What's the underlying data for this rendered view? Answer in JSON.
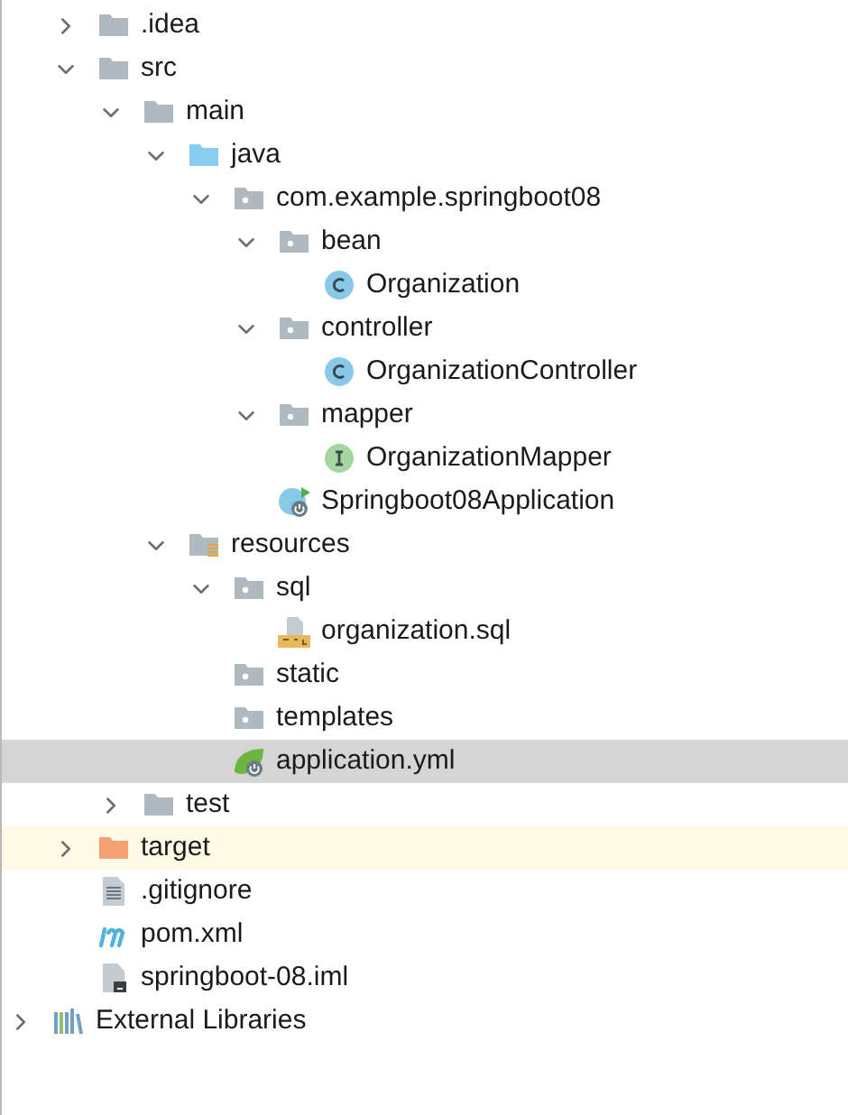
{
  "tree": [
    {
      "label": ".idea",
      "kind": "folder",
      "expanded": false,
      "selected": false,
      "highlighted": false
    },
    {
      "label": "src",
      "kind": "folder",
      "expanded": true,
      "selected": false,
      "highlighted": false,
      "children": [
        {
          "label": "main",
          "kind": "folder",
          "expanded": true,
          "selected": false,
          "highlighted": false,
          "children": [
            {
              "label": "java",
              "kind": "source_folder",
              "expanded": true,
              "selected": false,
              "highlighted": false,
              "children": [
                {
                  "label": "com.example.springboot08",
                  "kind": "package",
                  "expanded": true,
                  "selected": false,
                  "highlighted": false,
                  "children": [
                    {
                      "label": "bean",
                      "kind": "package",
                      "expanded": true,
                      "selected": false,
                      "highlighted": false,
                      "children": [
                        {
                          "label": "Organization",
                          "kind": "class",
                          "selected": false,
                          "highlighted": false
                        }
                      ]
                    },
                    {
                      "label": "controller",
                      "kind": "package",
                      "expanded": true,
                      "selected": false,
                      "highlighted": false,
                      "children": [
                        {
                          "label": "OrganizationController",
                          "kind": "class",
                          "selected": false,
                          "highlighted": false
                        }
                      ]
                    },
                    {
                      "label": "mapper",
                      "kind": "package",
                      "expanded": true,
                      "selected": false,
                      "highlighted": false,
                      "children": [
                        {
                          "label": "OrganizationMapper",
                          "kind": "interface",
                          "selected": false,
                          "highlighted": false
                        }
                      ]
                    },
                    {
                      "label": "Springboot08Application",
                      "kind": "spring_class",
                      "selected": false,
                      "highlighted": false
                    }
                  ]
                }
              ]
            },
            {
              "label": "resources",
              "kind": "resources_folder",
              "expanded": true,
              "selected": false,
              "highlighted": false,
              "children": [
                {
                  "label": "sql",
                  "kind": "package",
                  "expanded": true,
                  "selected": false,
                  "highlighted": false,
                  "children": [
                    {
                      "label": "organization.sql",
                      "kind": "sql_file",
                      "selected": false,
                      "highlighted": false
                    }
                  ]
                },
                {
                  "label": "static",
                  "kind": "package",
                  "selected": false,
                  "highlighted": false
                },
                {
                  "label": "templates",
                  "kind": "package",
                  "selected": false,
                  "highlighted": false
                },
                {
                  "label": "application.yml",
                  "kind": "spring_config",
                  "selected": true,
                  "highlighted": false
                }
              ]
            }
          ]
        },
        {
          "label": "test",
          "kind": "folder",
          "expanded": false,
          "selected": false,
          "highlighted": false
        }
      ]
    },
    {
      "label": "target",
      "kind": "excluded_folder",
      "expanded": false,
      "selected": false,
      "highlighted": true
    },
    {
      "label": ".gitignore",
      "kind": "text_file",
      "selected": false,
      "highlighted": false
    },
    {
      "label": "pom.xml",
      "kind": "maven_file",
      "selected": false,
      "highlighted": false
    },
    {
      "label": "springboot-08.iml",
      "kind": "module_file",
      "selected": false,
      "highlighted": false
    }
  ],
  "libraries_node": {
    "label": "External Libraries",
    "expanded": false,
    "selected": false
  }
}
